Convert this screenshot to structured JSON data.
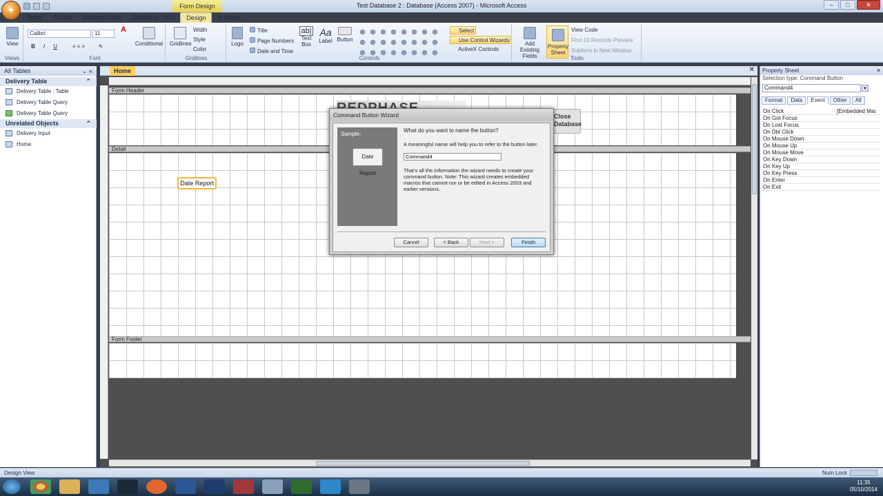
{
  "window": {
    "title": "Test Database 2 : Database (Access 2007) - Microsoft Access",
    "context_tab": "Form Design Tools"
  },
  "tabs": [
    "Home",
    "Create",
    "External Data",
    "Database Tools",
    "Design",
    "Arrange"
  ],
  "ribbon": {
    "views": {
      "view": "View",
      "label": "Views"
    },
    "font": {
      "family": "Calibri",
      "size": "11",
      "bold": "B",
      "italic": "I",
      "underline": "U",
      "conditional": "Conditional",
      "label": "Font"
    },
    "gridlines": {
      "gridlines": "Gridlines",
      "width": "Width",
      "style": "Style",
      "color": "Color",
      "label": "Gridlines"
    },
    "controls": {
      "logo": "Logo",
      "title": "Title",
      "page_numbers": "Page Numbers",
      "date_time": "Date and Time",
      "text_box": "Text Box",
      "label_btn": "Label",
      "button": "Button",
      "select": "Select",
      "use_wizards": "Use Control Wizards",
      "activex": "ActiveX Controls",
      "label": "Controls"
    },
    "tools": {
      "add_fields": "Add Existing Fields",
      "property_sheet": "Property Sheet",
      "view_code": "View Code",
      "first_ten": "First 10 Records Preview",
      "subform": "Subform in New Window",
      "label": "Tools"
    }
  },
  "nav": {
    "header": "All Tables",
    "groups": [
      {
        "name": "Delivery Table",
        "items": [
          "Delivery Table : Table",
          "Delivery Table Query",
          "Delivery Table Query"
        ]
      },
      {
        "name": "Unrelated Objects",
        "items": [
          "Delivery Input",
          "Home"
        ]
      }
    ]
  },
  "doc": {
    "tab": "Home",
    "sections": {
      "header": "Form Header",
      "detail": "Detail",
      "footer": "Form Footer"
    },
    "date_button": "Date Report",
    "logo_text": "REDPHASE",
    "close_db": "Close Database"
  },
  "wizard": {
    "title": "Command Button Wizard",
    "sample_label": "Sample:",
    "sample_button": "Date Report",
    "question": "What do you want to name the button?",
    "hint": "A meaningful name will help you to refer to the button later.",
    "name_value": "Command4",
    "info": "That's all the information the wizard needs to create your command button. Note: This wizard creates embedded macros that cannot run or be edited in Access 2003 and earlier versions.",
    "buttons": {
      "cancel": "Cancel",
      "back": "< Back",
      "next": "Next >",
      "finish": "Finish"
    }
  },
  "property_sheet": {
    "title": "Property Sheet",
    "selection_type": "Selection type:  Command Button",
    "selected": "Command4",
    "tabs": [
      "Format",
      "Data",
      "Event",
      "Other",
      "All"
    ],
    "active_tab": "Event",
    "rows": [
      {
        "k": "On Click",
        "v": "[Embedded Macro]"
      },
      {
        "k": "On Got Focus",
        "v": ""
      },
      {
        "k": "On Lost Focus",
        "v": ""
      },
      {
        "k": "On Dbl Click",
        "v": ""
      },
      {
        "k": "On Mouse Down",
        "v": ""
      },
      {
        "k": "On Mouse Up",
        "v": ""
      },
      {
        "k": "On Mouse Move",
        "v": ""
      },
      {
        "k": "On Key Down",
        "v": ""
      },
      {
        "k": "On Key Up",
        "v": ""
      },
      {
        "k": "On Key Press",
        "v": ""
      },
      {
        "k": "On Enter",
        "v": ""
      },
      {
        "k": "On Exit",
        "v": ""
      }
    ]
  },
  "status": {
    "left": "Design View",
    "num_lock": "Num Lock"
  },
  "clock": {
    "time": "11:35",
    "date": "05/10/2014"
  }
}
